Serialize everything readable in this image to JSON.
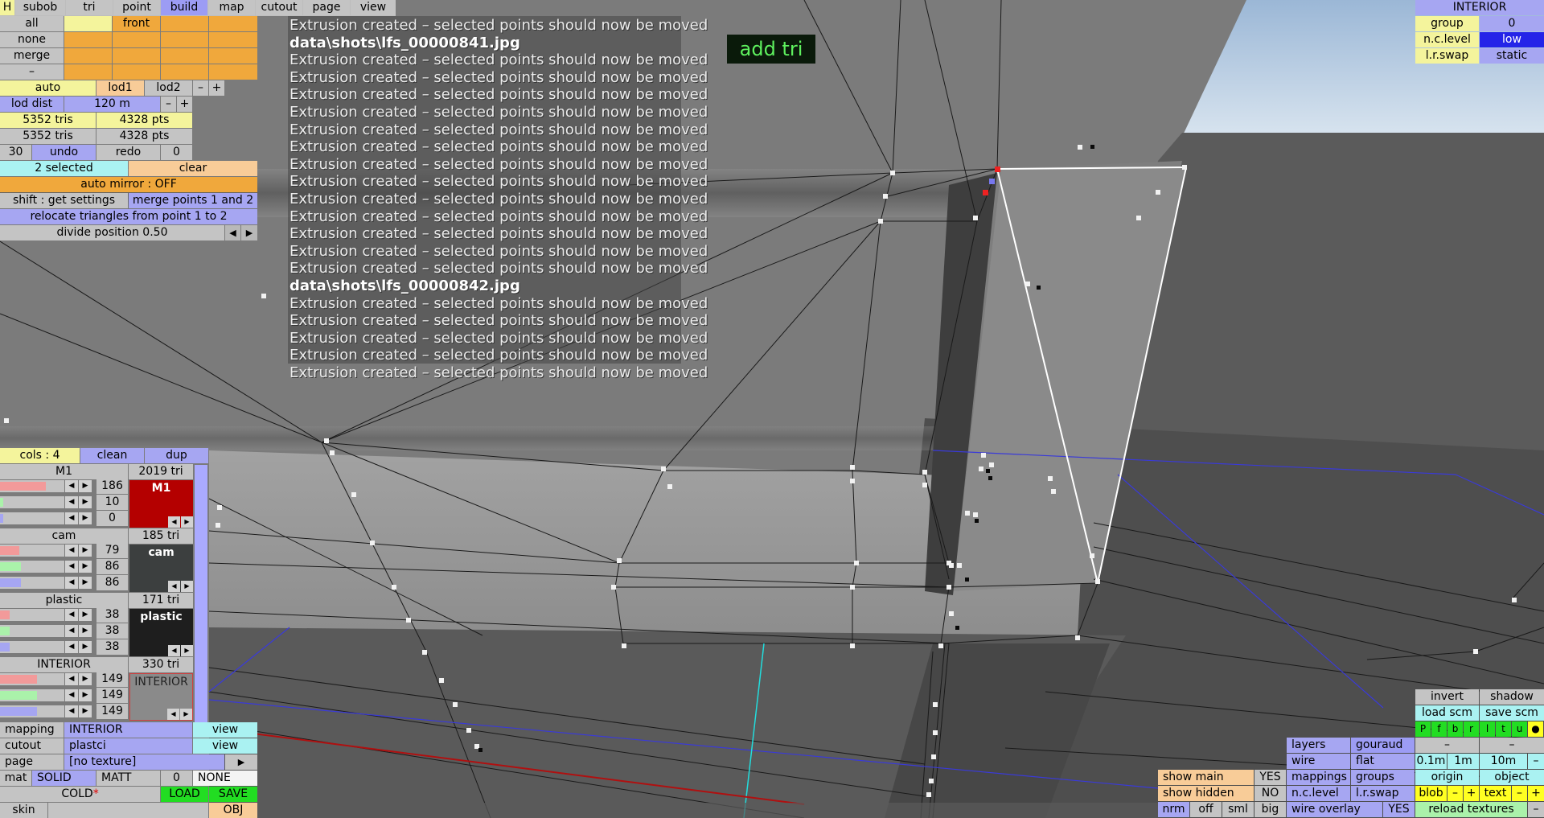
{
  "colors": {
    "accent_blue": "#a6a6f2",
    "orange": "#f0a83c",
    "yellow": "#f4f49c",
    "log_text": "#ececec",
    "add_tri_text": "#5ef05e",
    "selected_edge": "#ffffff",
    "mat_m1": "#b40000",
    "mat_cam": "#3c3f3f",
    "mat_plastic": "#1e1e1e",
    "mat_interior": "#8a8a8a"
  },
  "top_menu": {
    "h": "H",
    "subob": "subob",
    "tri": "tri",
    "point": "point",
    "build": "build",
    "map": "map",
    "cutout": "cutout",
    "page": "page",
    "view": "view"
  },
  "left_panel": {
    "all": "all",
    "front": "front",
    "none": "none",
    "merge": "merge",
    "dash": "–",
    "auto": "auto",
    "lod1": "lod1",
    "lod2": "lod2",
    "minus": "–",
    "plus": "+",
    "lod_dist_label": "lod dist",
    "lod_dist_value": "120 m",
    "tris_1": "5352 tris",
    "pts_1": "4328 pts",
    "tris_2": "5352 tris",
    "pts_2": "4328 pts",
    "undo_count": "30",
    "undo": "undo",
    "redo": "redo",
    "redo_count": "0",
    "selected": "2 selected",
    "clear": "clear",
    "auto_mirror": "auto mirror : OFF",
    "shift_settings": "shift : get settings",
    "merge_points": "merge points 1 and 2",
    "relocate": "relocate triangles from point 1 to 2",
    "divide": "divide position 0.50",
    "left_arrow": "◀",
    "right_arrow": "▶"
  },
  "log": {
    "lines": [
      "Extrusion created – selected points should now be moved",
      "data\\shots\\lfs_00000841.jpg",
      "Extrusion created – selected points should now be moved",
      "Extrusion created – selected points should now be moved",
      "Extrusion created – selected points should now be moved",
      "Extrusion created – selected points should now be moved",
      "Extrusion created – selected points should now be moved",
      "Extrusion created – selected points should now be moved",
      "Extrusion created – selected points should now be moved",
      "Extrusion created – selected points should now be moved",
      "Extrusion created – selected points should now be moved",
      "Extrusion created – selected points should now be moved",
      "Extrusion created – selected points should now be moved",
      "Extrusion created – selected points should now be moved",
      "Extrusion created – selected points should now be moved",
      "data\\shots\\lfs_00000842.jpg",
      "Extrusion created – selected points should now be moved",
      "Extrusion created – selected points should now be moved",
      "Extrusion created – selected points should now be moved",
      "Extrusion created – selected points should now be moved",
      "Extrusion created – selected points should now be moved"
    ],
    "file_lines": [
      1,
      15
    ]
  },
  "add_tri": "add tri",
  "top_right": {
    "title": "INTERIOR",
    "group_label": "group",
    "group_value": "0",
    "nc_level_label": "n.c.level",
    "nc_level_value": "low",
    "lr_swap_label": "l.r.swap",
    "lr_swap_value": "static"
  },
  "materials": {
    "cols": "cols : 4",
    "clean": "clean",
    "dup": "dup",
    "items": [
      {
        "name": "M1",
        "tri": "2019 tri",
        "r": "186",
        "g": "10",
        "b": "0",
        "swatch_label": "M1"
      },
      {
        "name": "cam",
        "tri": "185 tri",
        "r": "79",
        "g": "86",
        "b": "86",
        "swatch_label": "cam"
      },
      {
        "name": "plastic",
        "tri": "171 tri",
        "r": "38",
        "g": "38",
        "b": "38",
        "swatch_label": "plastic"
      },
      {
        "name": "INTERIOR",
        "tri": "330 tri",
        "r": "149",
        "g": "149",
        "b": "149",
        "swatch_label": "INTERIOR"
      }
    ],
    "arrow_left": "◀",
    "arrow_right": "▶"
  },
  "bottom_left": {
    "mapping_label": "mapping",
    "mapping_value": "INTERIOR",
    "mapping_view": "view",
    "cutout_label": "cutout",
    "cutout_value": "plastci",
    "cutout_view": "view",
    "page_label": "page",
    "page_value": "[no texture]",
    "page_arrow": "▶",
    "mat_label": "mat",
    "solid": "SOLID",
    "matt": "MATT",
    "zero": "0",
    "none": "NONE",
    "cold": "COLD",
    "star": "*",
    "load": "LOAD",
    "save": "SAVE",
    "skin": "skin",
    "obj": "OBJ"
  },
  "bottom_right": {
    "invert": "invert",
    "shadow": "shadow",
    "load_scm": "load scm",
    "save_scm": "save scm",
    "view_buttons": [
      "P",
      "f",
      "b",
      "r",
      "l",
      "t",
      "u",
      "●"
    ],
    "dash": "–",
    "layers": "layers",
    "gouraud": "gouraud",
    "wire": "wire",
    "flat": "flat",
    "dist_01": "0.1m",
    "dist_1": "1m",
    "dist_10": "10m",
    "mappings": "mappings",
    "groups": "groups",
    "origin": "origin",
    "object": "object",
    "show_main": "show main",
    "show_main_val": "YES",
    "show_hidden": "show hidden",
    "show_hidden_val": "NO",
    "nc_level": "n.c.level",
    "lr_swap": "l.r.swap",
    "blob": "blob",
    "minus": "–",
    "plus": "+",
    "text": "text",
    "nrm": "nrm",
    "off": "off",
    "sml": "sml",
    "big": "big",
    "wire_overlay": "wire overlay",
    "wire_overlay_val": "YES",
    "reload_textures": "reload textures"
  }
}
